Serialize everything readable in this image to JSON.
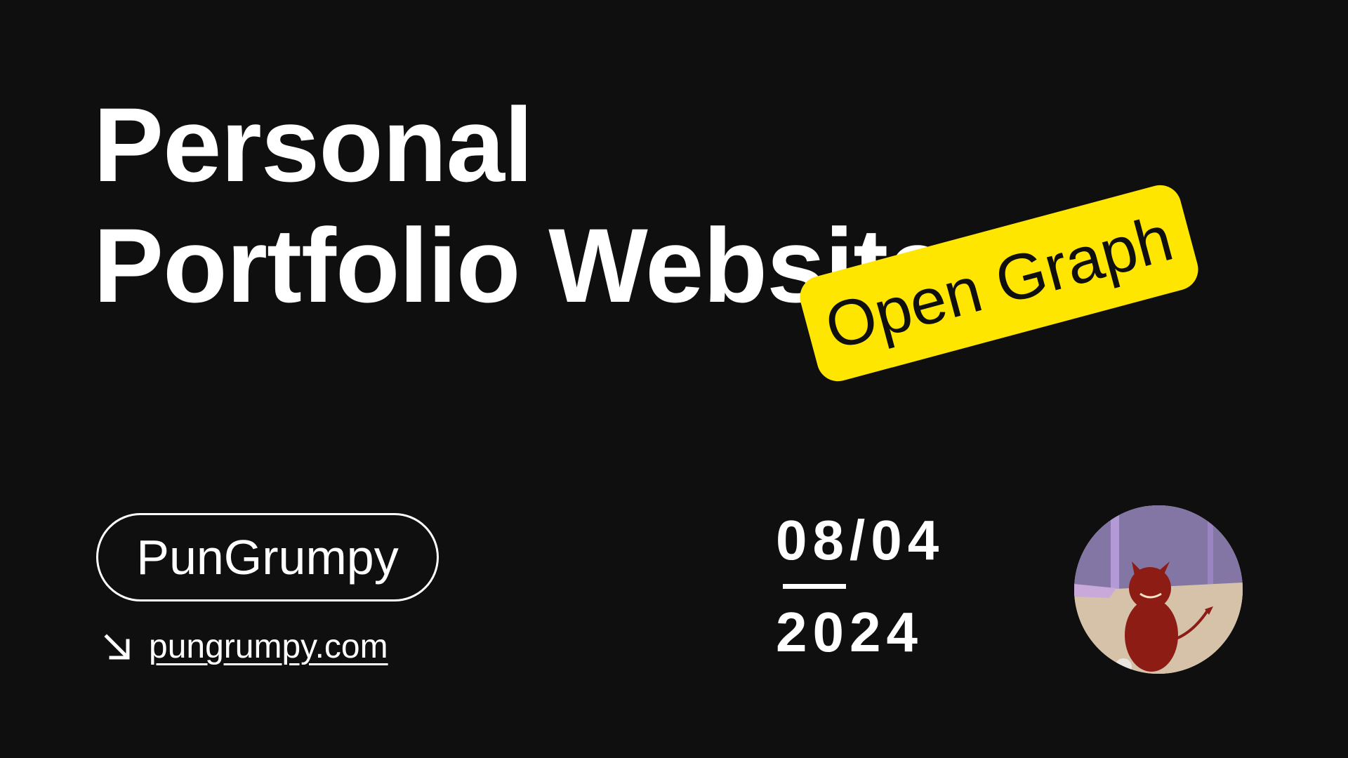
{
  "title": {
    "line1": "Personal",
    "line2": "Portfolio Website"
  },
  "badge": {
    "label": "Open Graph",
    "color": "#ffe600"
  },
  "author": {
    "name": "PunGrumpy"
  },
  "link": {
    "icon": "arrow-down-right-icon",
    "url_text": "pungrumpy.com"
  },
  "date": {
    "day_month": "08/04",
    "year": "2024"
  },
  "avatar": {
    "icon": "avatar-image"
  },
  "colors": {
    "background": "#0f0f0f",
    "text": "#ffffff",
    "accent": "#ffe600"
  }
}
